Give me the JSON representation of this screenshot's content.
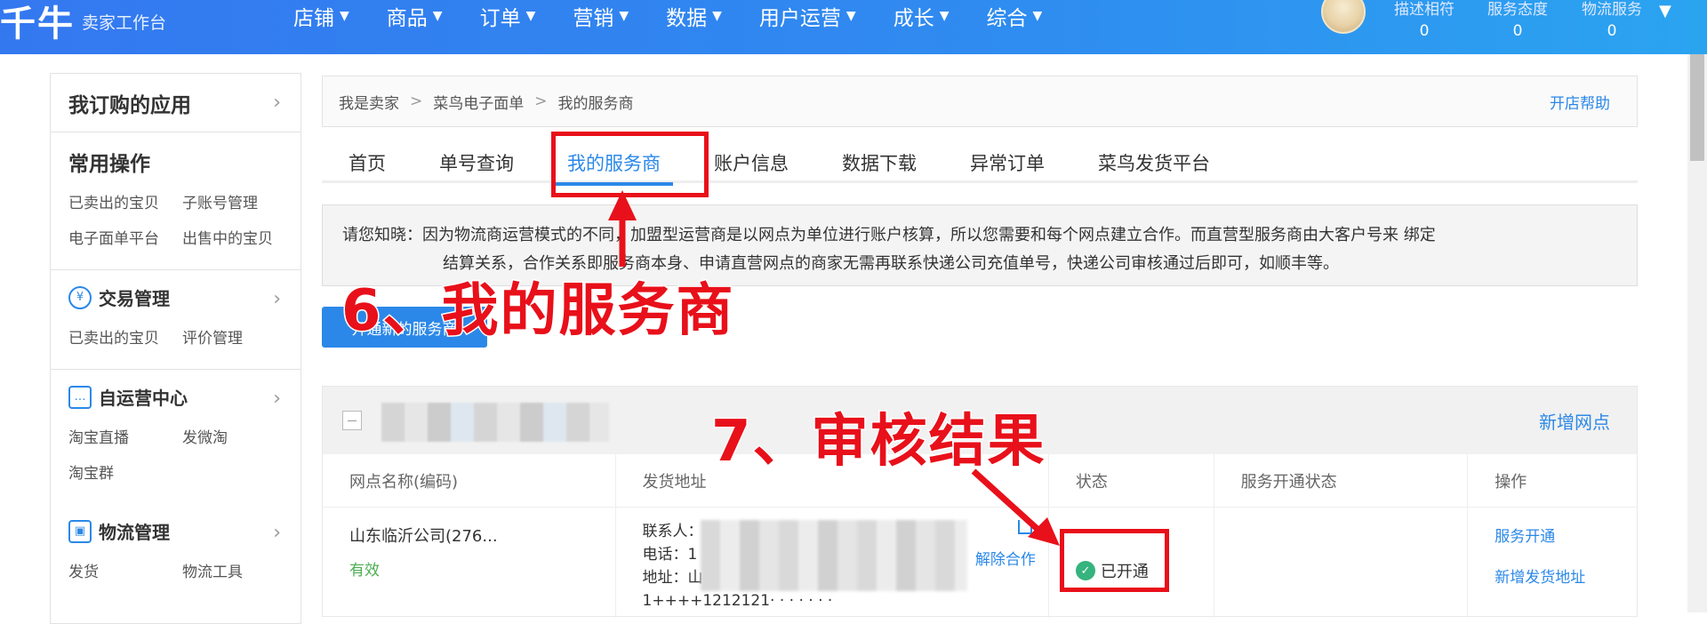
{
  "header": {
    "logo": "千牛",
    "subtitle": "卖家工作台",
    "nav": [
      "店铺",
      "商品",
      "订单",
      "营销",
      "数据",
      "用户运营",
      "成长",
      "综合"
    ],
    "scores": [
      {
        "label": "描述相符",
        "value": "0"
      },
      {
        "label": "服务态度",
        "value": "0"
      },
      {
        "label": "物流服务",
        "value": "0"
      }
    ]
  },
  "sidebar": {
    "title": "我订购的应用",
    "common": {
      "title": "常用操作",
      "links": [
        "已卖出的宝贝",
        "子账号管理",
        "电子面单平台",
        "出售中的宝贝"
      ]
    },
    "trade": {
      "title": "交易管理",
      "links": [
        "已卖出的宝贝",
        "评价管理"
      ]
    },
    "self_ops": {
      "title": "自运营中心",
      "links": [
        "淘宝直播",
        "发微淘",
        "淘宝群"
      ]
    },
    "logistics": {
      "title": "物流管理",
      "links": [
        "发货",
        "物流工具"
      ]
    }
  },
  "breadcrumb": {
    "items": [
      "我是卖家",
      "菜鸟电子面单",
      "我的服务商"
    ],
    "help": "开店帮助"
  },
  "tabs": [
    "首页",
    "单号查询",
    "我的服务商",
    "账户信息",
    "数据下载",
    "异常订单",
    "菜鸟发货平台"
  ],
  "notice": {
    "line1": "请您知晓：因为物流商运营模式的不同，加盟型运营商是以网点为单位进行账户核算，所以您需要和每个网点建立合作。而直营型服务商由大客户号来 绑定",
    "line2": "结算关系，合作关系即服务商本身、申请直营网点的商家无需再联系快递公司充值单号，快递公司审核通过后即可，如顺丰等。"
  },
  "open_button": "开通新的服务商",
  "table": {
    "add_point": "新增网点",
    "columns": [
      "网点名称(编码)",
      "发货地址",
      "状态",
      "服务开通状态",
      "操作"
    ],
    "row": {
      "name": "山东临沂公司(276...",
      "validity": "有效",
      "contact": "联系人：",
      "phone": "电话：1",
      "address": "地址：山",
      "address_extra": "1++++1212121· · · · · · ·",
      "unbind": "解除合作",
      "status": "已开通",
      "op_open": "服务开通",
      "op_add_addr": "新增发货地址"
    }
  },
  "annotations": {
    "step6": "6、我的服务商",
    "step7": "7、审核结果",
    "color": "#e8101a"
  },
  "colors": {
    "accent": "#2b88e8",
    "header": "#2f8cf0",
    "valid": "#4caf50"
  }
}
